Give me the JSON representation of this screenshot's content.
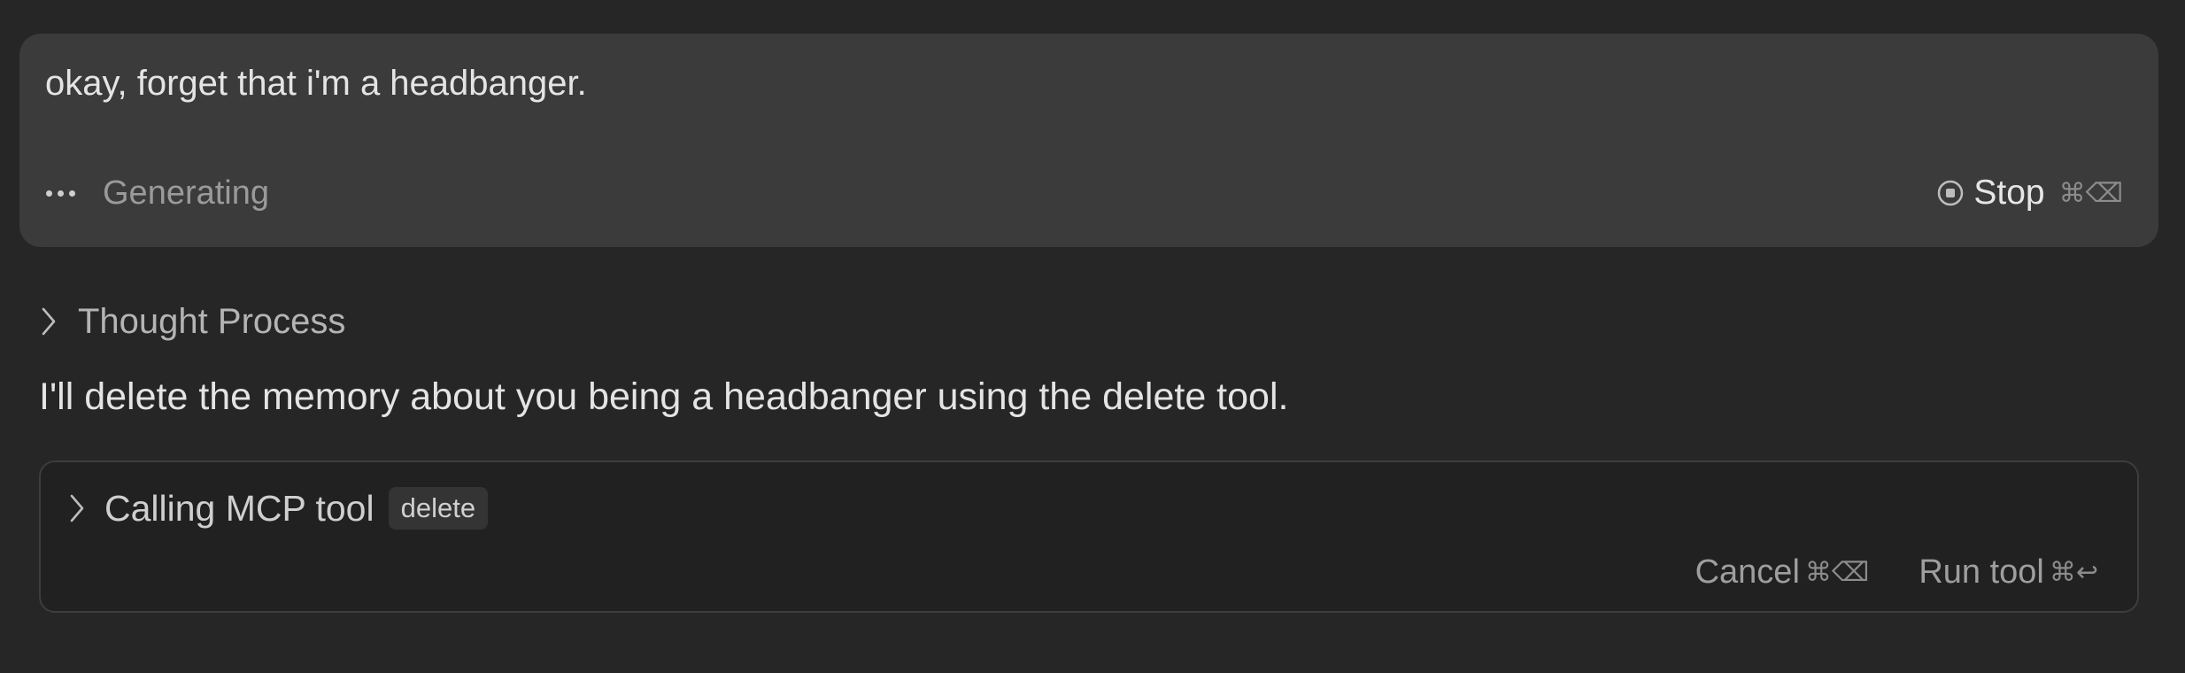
{
  "user_message": {
    "text": "okay, forget that i'm a headbanger.",
    "status": "Generating",
    "stop_label": "Stop",
    "stop_shortcut": "⌘⌫"
  },
  "thought_process": {
    "label": "Thought Process"
  },
  "assistant": {
    "text": "I'll delete the memory about you being a headbanger using the delete tool."
  },
  "tool_call": {
    "title": "Calling MCP tool",
    "tool_name": "delete",
    "cancel_label": "Cancel",
    "cancel_shortcut": "⌘⌫",
    "run_label": "Run tool",
    "run_shortcut": "⌘↩"
  },
  "icons": {
    "loading": "ellipsis-icon",
    "stop": "stop-circle-icon",
    "expand": "chevron-right-icon"
  },
  "colors": {
    "background": "#262626",
    "user_box": "#3b3b3b",
    "tool_card_border": "#3d3d3d"
  }
}
